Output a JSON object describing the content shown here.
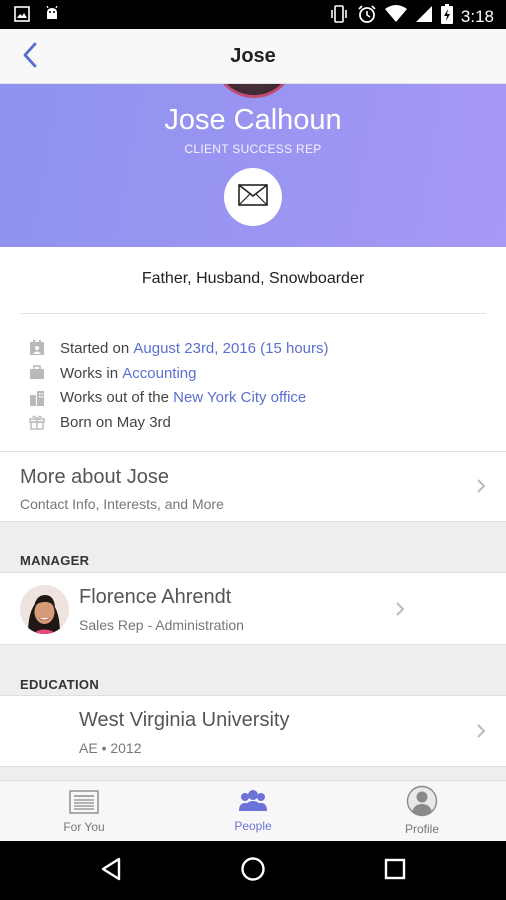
{
  "status_bar": {
    "time": "3:18",
    "left_icons": [
      "image-icon",
      "android-icon"
    ],
    "right_icons": [
      "vibrate-icon",
      "alarm-icon",
      "wifi-icon",
      "cellular-icon",
      "battery-icon"
    ]
  },
  "app_bar": {
    "title": "Jose",
    "back_icon": "chevron-left-icon"
  },
  "profile": {
    "name": "Jose Calhoun",
    "role": "CLIENT SUCCESS REP",
    "mail_icon": "envelope-icon",
    "bio": "Father, Husband, Snowboarder"
  },
  "facts": [
    {
      "icon": "calendar-icon",
      "prefix": "Started on ",
      "link": "August 23rd, 2016 (15 hours)"
    },
    {
      "icon": "briefcase-icon",
      "prefix": "Works in ",
      "link": "Accounting"
    },
    {
      "icon": "building-icon",
      "prefix": "Works out of the ",
      "link": "New York City office"
    },
    {
      "icon": "gift-icon",
      "prefix": "Born on May 3rd",
      "link": ""
    }
  ],
  "more_about": {
    "title": "More about Jose",
    "subtitle": "Contact Info, Interests, and More"
  },
  "manager": {
    "section_label": "MANAGER",
    "name": "Florence Ahrendt",
    "subtitle": "Sales Rep - Administration"
  },
  "education": {
    "section_label": "EDUCATION",
    "school": "West Virginia University",
    "subtitle": "AE • 2012"
  },
  "tabs": [
    {
      "label": "For You",
      "icon": "newspaper-icon",
      "active": false
    },
    {
      "label": "People",
      "icon": "people-icon",
      "active": true
    },
    {
      "label": "Profile",
      "icon": "person-icon",
      "active": false
    }
  ],
  "colors": {
    "accent": "#6b73d9",
    "link": "#5b6fd1",
    "banner_start": "#8f92f0",
    "banner_end": "#a799f5"
  }
}
